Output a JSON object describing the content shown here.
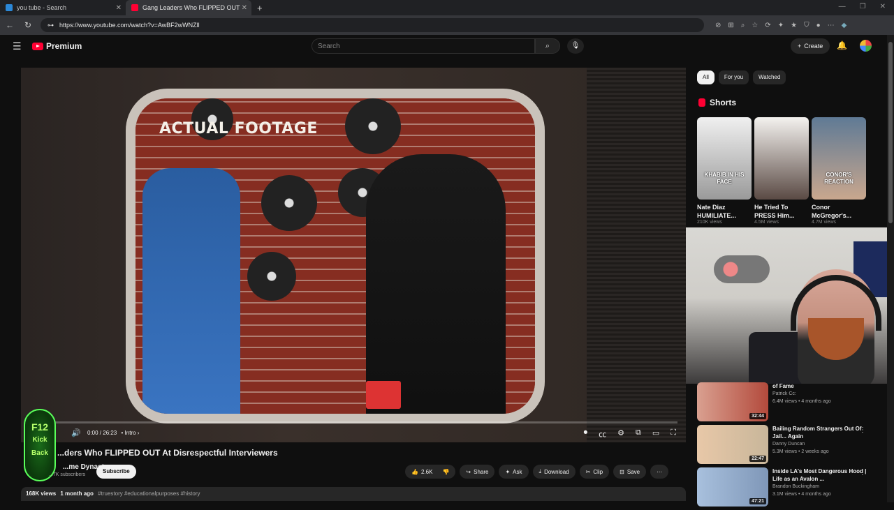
{
  "browser": {
    "tabs": [
      {
        "label": "you tube - Search",
        "active": false
      },
      {
        "label": "Gang Leaders Who FLIPPED OUT",
        "active": true
      }
    ],
    "new_tab": "+",
    "url": "https://www.youtube.com/watch?v=AwBF2wWNZll"
  },
  "header": {
    "brand": "Premium",
    "search_placeholder": "Search",
    "create_label": "Create"
  },
  "player": {
    "overlay_text": "ACTUAL FOOTAGE",
    "time": "0:00 / 26:23",
    "chapter": "• Intro",
    "progress": 0
  },
  "video": {
    "title": "...ders Who FLIPPED OUT At Disrespectful Interviewers",
    "channel_name": "...me Dynasty",
    "subscribers": "...7K subscribers",
    "subscribe_label": "Subscribe",
    "likes": "2.6K",
    "share_label": "Share",
    "ask_label": "Ask",
    "download_label": "Download",
    "clip_label": "Clip",
    "save_label": "Save",
    "views": "168K views",
    "age": "1 month ago",
    "tags": "#truestory #educationalpurposes #history"
  },
  "overlay_logo": {
    "text": "F12 Kick Back"
  },
  "sidebar": {
    "chips": [
      "All",
      "For you",
      "Watched"
    ],
    "shorts_title": "Shorts",
    "shorts": [
      {
        "caption": "KHABIB IN HIS FACE",
        "title": "Nate Diaz HUMILIATE...",
        "views": "210K views",
        "color": "#cfcfcf"
      },
      {
        "caption": "",
        "title": "He Tried To PRESS Him...",
        "views": "4.5M views",
        "color": "#e9e6e2"
      },
      {
        "caption": "CONOR'S REACTION",
        "title": "Conor McGregor's...",
        "views": "4.7M views",
        "color": "#c9a78e"
      }
    ],
    "recommendations": [
      {
        "title": "of Fame",
        "channel": "Patrick Cc:",
        "stats": "6.4M views • 4 months ago",
        "duration": "32:44",
        "color": "#b34a3c"
      },
      {
        "title": "Bailing Random Strangers Out Of Jail... Again",
        "channel": "Danny Duncan",
        "stats": "5.3M views • 2 weeks ago",
        "duration": "22:47",
        "color": "#c8b69a"
      },
      {
        "title": "Inside LA's Most Dangerous Hood | Life as an Avalon ...",
        "channel": "Brandon Buckingham",
        "stats": "3.1M views • 4 months ago",
        "duration": "47:21",
        "color": "#7f97b8"
      }
    ]
  }
}
